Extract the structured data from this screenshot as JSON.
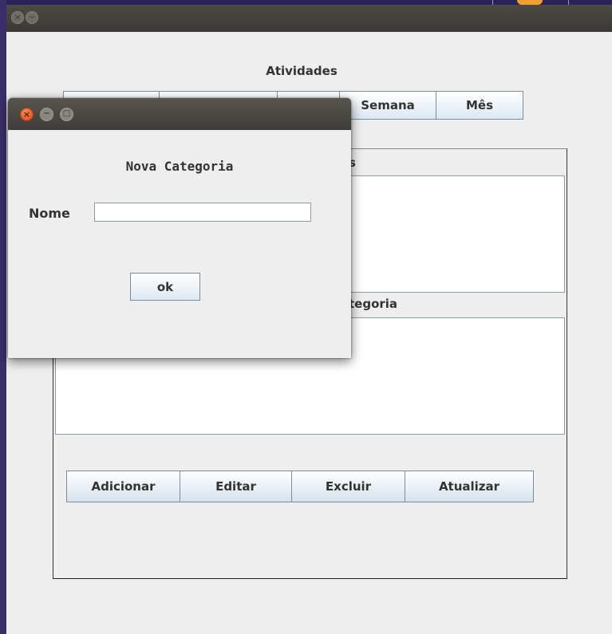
{
  "main_window": {
    "title": "Atividades",
    "tabs": [
      {
        "label": ""
      },
      {
        "label": ""
      },
      {
        "label": ""
      },
      {
        "label": "Semana"
      },
      {
        "label": "Mês"
      }
    ],
    "list1_label": "s",
    "list2_label": "tegoria",
    "actions": [
      {
        "label": "Adicionar"
      },
      {
        "label": "Editar"
      },
      {
        "label": "Excluir"
      },
      {
        "label": "Atualizar"
      }
    ]
  },
  "dialog": {
    "heading": "Nova Categoria",
    "name_label": "Nome",
    "name_value": "",
    "ok_label": "ok"
  },
  "icons": {
    "close": "close-icon",
    "minimize": "minimize-icon",
    "maximize": "maximize-icon"
  },
  "colors": {
    "window_bg": "#eeeeee",
    "titlebar": "#3f3d39",
    "close_button": "#dd4814",
    "desktop": "#2f2a5a"
  }
}
